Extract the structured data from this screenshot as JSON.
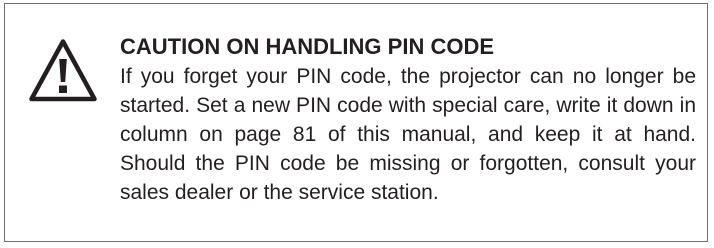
{
  "caution": {
    "icon": "warning-triangle-icon",
    "title": "CAUTION ON HANDLING PIN CODE",
    "body": "If you forget your PIN code, the projector can no longer be started. Set a new PIN code with special care, write it down in column on page 81 of this manual, and keep it at hand. Should the PIN code be missing or forgotten, consult your sales dealer or the service station."
  },
  "colors": {
    "text": "#231f20",
    "border": "#6f6f6f",
    "background": "#ffffff"
  }
}
